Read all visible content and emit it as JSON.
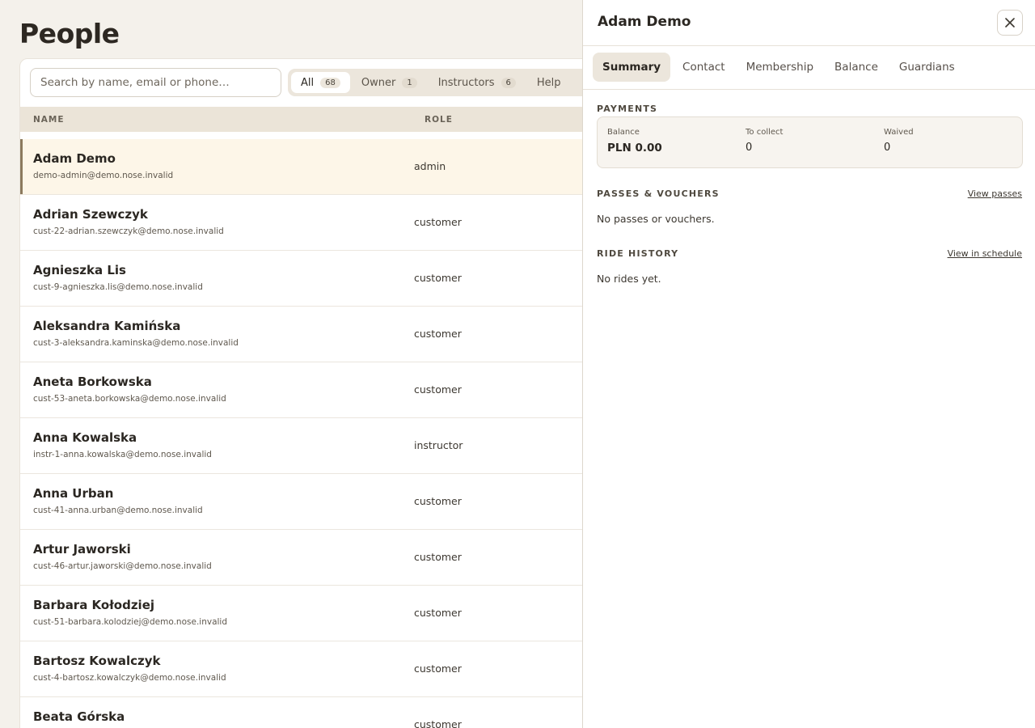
{
  "page": {
    "title": "People"
  },
  "search": {
    "placeholder": "Search by name, email or phone…"
  },
  "filters": [
    {
      "label": "All",
      "count": "68"
    },
    {
      "label": "Owner",
      "count": "1"
    },
    {
      "label": "Instructors",
      "count": "6"
    },
    {
      "label": "Help",
      "count": ""
    }
  ],
  "table": {
    "headers": {
      "name": "NAME",
      "role": "ROLE"
    },
    "rows": [
      {
        "name": "Adam Demo",
        "email": "demo-admin@demo.nose.invalid",
        "role": "admin"
      },
      {
        "name": "Adrian Szewczyk",
        "email": "cust-22-adrian.szewczyk@demo.nose.invalid",
        "role": "customer"
      },
      {
        "name": "Agnieszka Lis",
        "email": "cust-9-agnieszka.lis@demo.nose.invalid",
        "role": "customer"
      },
      {
        "name": "Aleksandra Kamińska",
        "email": "cust-3-aleksandra.kaminska@demo.nose.invalid",
        "role": "customer"
      },
      {
        "name": "Aneta Borkowska",
        "email": "cust-53-aneta.borkowska@demo.nose.invalid",
        "role": "customer"
      },
      {
        "name": "Anna Kowalska",
        "email": "instr-1-anna.kowalska@demo.nose.invalid",
        "role": "instructor"
      },
      {
        "name": "Anna Urban",
        "email": "cust-41-anna.urban@demo.nose.invalid",
        "role": "customer"
      },
      {
        "name": "Artur Jaworski",
        "email": "cust-46-artur.jaworski@demo.nose.invalid",
        "role": "customer"
      },
      {
        "name": "Barbara Kołodziej",
        "email": "cust-51-barbara.kolodziej@demo.nose.invalid",
        "role": "customer"
      },
      {
        "name": "Bartosz Kowalczyk",
        "email": "cust-4-bartosz.kowalczyk@demo.nose.invalid",
        "role": "customer"
      },
      {
        "name": "Beata Górska",
        "email": "",
        "role": "customer"
      }
    ]
  },
  "drawer": {
    "title": "Adam Demo",
    "close_icon": "close-icon",
    "tabs": [
      "Summary",
      "Contact",
      "Membership",
      "Balance",
      "Guardians"
    ],
    "payments": {
      "heading": "PAYMENTS",
      "balance_label": "Balance",
      "balance_value": "PLN 0.00",
      "collect_label": "To collect",
      "collect_value": "0",
      "waived_label": "Waived",
      "waived_value": "0"
    },
    "passes": {
      "heading": "PASSES & VOUCHERS",
      "link": "View passes",
      "empty": "No passes or vouchers."
    },
    "rides": {
      "heading": "RIDE HISTORY",
      "link": "View in schedule",
      "empty": "No rides yet."
    }
  }
}
